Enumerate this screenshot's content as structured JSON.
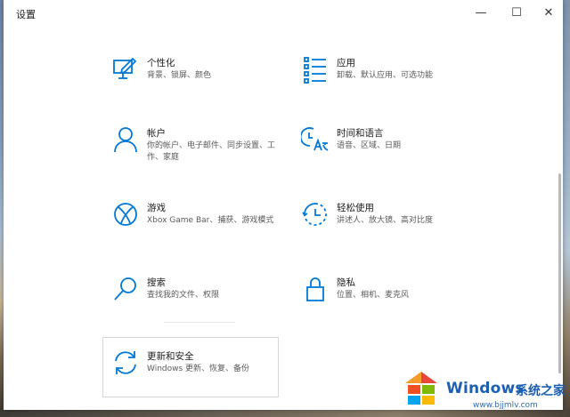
{
  "window": {
    "title": "设置",
    "minimize_glyph": "—",
    "maximize_glyph": "☐",
    "close_glyph": "✕"
  },
  "accent_color": "#0078d7",
  "categories": [
    {
      "name": "个性化",
      "desc": "背景、锁屏、颜色",
      "icon": "personalization-icon"
    },
    {
      "name": "应用",
      "desc": "卸载、默认应用、可选功能",
      "icon": "apps-icon"
    },
    {
      "name": "帐户",
      "desc": "你的帐户、电子邮件、同步设置、工作、家庭",
      "icon": "accounts-icon"
    },
    {
      "name": "时间和语言",
      "desc": "语音、区域、日期",
      "icon": "time-language-icon"
    },
    {
      "name": "游戏",
      "desc": "Xbox Game Bar、捕获、游戏模式",
      "icon": "xbox-icon"
    },
    {
      "name": "轻松使用",
      "desc": "讲述人、放大镜、高对比度",
      "icon": "ease-of-access-icon"
    },
    {
      "name": "搜索",
      "desc": "查找我的文件、权限",
      "icon": "search-icon"
    },
    {
      "name": "隐私",
      "desc": "位置、相机、麦克风",
      "icon": "lock-icon"
    },
    {
      "name": "更新和安全",
      "desc": "Windows 更新、恢复、备份",
      "icon": "update-icon"
    }
  ],
  "watermark": {
    "brand": "Windows",
    "brand_suffix": "系统之家",
    "url": "www.bjjmlv.com"
  }
}
